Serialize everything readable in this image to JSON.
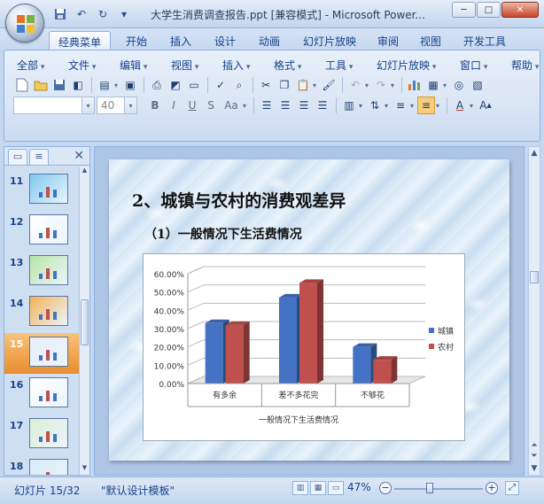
{
  "window": {
    "title": "大学生消费调查报告.ppt [兼容模式] - Microsoft Power...",
    "controls": {
      "minimize": "─",
      "maximize": "□",
      "close": "✕"
    }
  },
  "quick_access": [
    "save-icon",
    "undo-icon",
    "redo-icon",
    "customize-icon"
  ],
  "tabs": [
    {
      "label": "经典菜单",
      "active": true
    },
    {
      "label": "开始"
    },
    {
      "label": "插入"
    },
    {
      "label": "设计"
    },
    {
      "label": "动画"
    },
    {
      "label": "幻灯片放映"
    },
    {
      "label": "审阅"
    },
    {
      "label": "视图"
    },
    {
      "label": "开发工具"
    }
  ],
  "menus": [
    "全部",
    "文件",
    "编辑",
    "视图",
    "插入",
    "格式",
    "工具",
    "幻灯片放映",
    "窗口",
    "帮助"
  ],
  "format": {
    "font_name": "",
    "font_size": "40",
    "bold": "B",
    "italic": "I",
    "underline": "U",
    "shadow": "S",
    "case": "Aa"
  },
  "slides_panel": {
    "items": [
      {
        "num": "11",
        "selected": false
      },
      {
        "num": "12",
        "selected": false
      },
      {
        "num": "13",
        "selected": false
      },
      {
        "num": "14",
        "selected": false
      },
      {
        "num": "15",
        "selected": true
      },
      {
        "num": "16",
        "selected": false
      },
      {
        "num": "17",
        "selected": false
      },
      {
        "num": "18",
        "selected": false
      }
    ]
  },
  "slide": {
    "title": "2、城镇与农村的消费观差异",
    "subtitle": "（1）一般情况下生活费情况"
  },
  "chart_data": {
    "type": "bar",
    "categories": [
      "有多余",
      "差不多花完",
      "不够花"
    ],
    "series": [
      {
        "name": "城镇",
        "values": [
          0.33,
          0.47,
          0.2
        ],
        "color": "#4472c4"
      },
      {
        "name": "农村",
        "values": [
          0.32,
          0.55,
          0.13
        ],
        "color": "#c0504d"
      }
    ],
    "ylim": [
      0,
      0.6
    ],
    "yticks": [
      "0.00%",
      "10.00%",
      "20.00%",
      "30.00%",
      "40.00%",
      "50.00%",
      "60.00%"
    ],
    "xlabel": "一般情况下生活费情况",
    "legend": "right",
    "grid": true
  },
  "status": {
    "slide_info": "幻灯片 15/32",
    "template": "\"默认设计模板\"",
    "zoom": "47%",
    "zoom_fraction": 0.4
  }
}
